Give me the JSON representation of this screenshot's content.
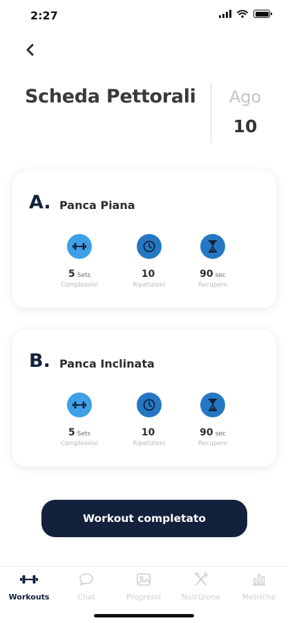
{
  "status_bar": {
    "time": "2:27"
  },
  "header": {
    "title": "Scheda Pettorali",
    "month": "Ago",
    "day": "10"
  },
  "exercises": [
    {
      "letter": "A.",
      "name": "Panca Piana",
      "stats": [
        {
          "icon": "dumbbell-icon",
          "value": "5",
          "unit": "Sets",
          "label": "Complessivi"
        },
        {
          "icon": "clock-icon",
          "value": "10",
          "unit": "",
          "label": "Ripetizioni"
        },
        {
          "icon": "hourglass-icon",
          "value": "90",
          "unit": "sec",
          "label": "Recupero"
        }
      ]
    },
    {
      "letter": "B.",
      "name": "Panca Inclinata",
      "stats": [
        {
          "icon": "dumbbell-icon",
          "value": "5",
          "unit": "Sets",
          "label": "Complessivi"
        },
        {
          "icon": "clock-icon",
          "value": "10",
          "unit": "",
          "label": "Ripetizioni"
        },
        {
          "icon": "hourglass-icon",
          "value": "90",
          "unit": "sec",
          "label": "Recupero"
        }
      ]
    }
  ],
  "cta": {
    "label": "Workout completato"
  },
  "tabs": [
    {
      "label": "Workouts",
      "icon": "dumbbell-icon",
      "active": true
    },
    {
      "label": "Chat",
      "icon": "chat-icon",
      "active": false
    },
    {
      "label": "Progressi",
      "icon": "photo-icon",
      "active": false
    },
    {
      "label": "Nutrizione",
      "icon": "cutlery-icon",
      "active": false
    },
    {
      "label": "Metriche",
      "icon": "bar-chart-icon",
      "active": false
    }
  ],
  "colors": {
    "primary_navy": "#13213d",
    "icon_blue_light": "#3ea1e5",
    "icon_blue_dark": "#2478c3",
    "inactive_gray": "#cfcfcf"
  }
}
